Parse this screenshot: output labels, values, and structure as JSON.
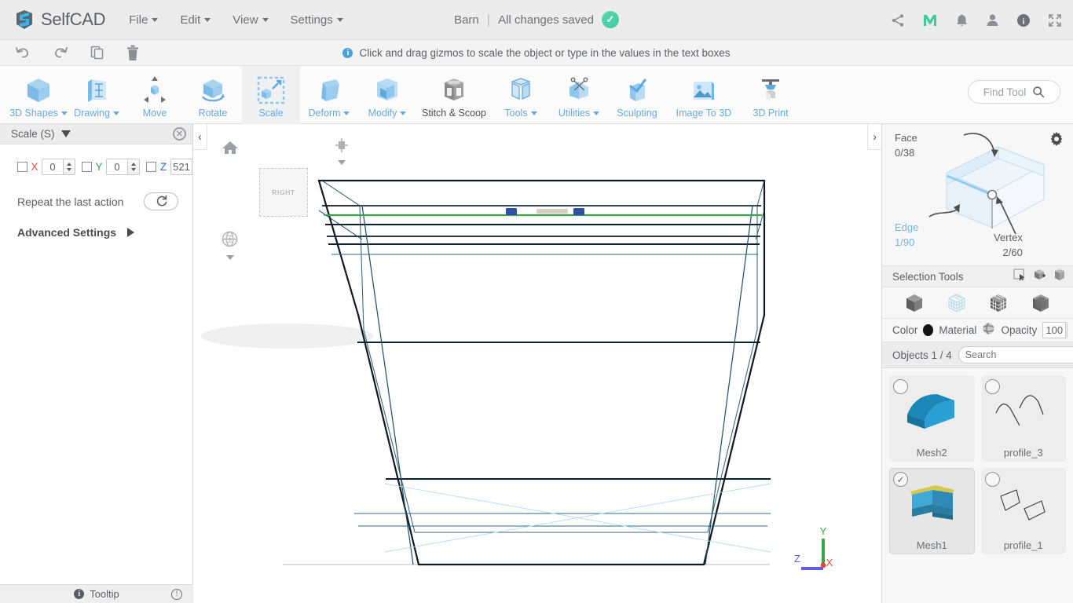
{
  "header": {
    "brand": "SelfCAD",
    "menus": [
      {
        "label": "File",
        "has_caret": true
      },
      {
        "label": "Edit",
        "has_caret": true
      },
      {
        "label": "View",
        "has_caret": true
      },
      {
        "label": "Settings",
        "has_caret": true
      }
    ],
    "doc_title": "Barn",
    "divider": "|",
    "save_status": "All changes saved",
    "icons": [
      {
        "name": "share-icon"
      },
      {
        "name": "m-logo-icon",
        "color": "#3fc9a0"
      },
      {
        "name": "bell-icon"
      },
      {
        "name": "user-icon"
      },
      {
        "name": "info-icon"
      },
      {
        "name": "fullscreen-icon"
      }
    ]
  },
  "subbar": {
    "undo_label": "Undo",
    "redo_label": "Redo",
    "copy_label": "Copy",
    "delete_label": "Delete",
    "hint": "Click and drag gizmos to scale the object or type in the values in the text boxes",
    "info_glyph": "i"
  },
  "ribbon": {
    "items": [
      {
        "label": "3D Shapes",
        "icon": "cube-icon",
        "caret": true,
        "active": false,
        "dark": false
      },
      {
        "label": "Drawing",
        "icon": "drawing-icon",
        "caret": true,
        "active": false,
        "dark": false
      },
      {
        "label": "Move",
        "icon": "move-icon",
        "caret": false,
        "active": false,
        "dark": false
      },
      {
        "label": "Rotate",
        "icon": "rotate-icon",
        "caret": false,
        "active": false,
        "dark": false
      },
      {
        "label": "Scale",
        "icon": "scale-icon",
        "caret": false,
        "active": true,
        "dark": false
      },
      {
        "label": "Deform",
        "icon": "deform-icon",
        "caret": true,
        "active": false,
        "dark": false
      },
      {
        "label": "Modify",
        "icon": "modify-icon",
        "caret": true,
        "active": false,
        "dark": false
      },
      {
        "label": "Stitch & Scoop",
        "icon": "stitch-scoop-icon",
        "caret": false,
        "active": false,
        "dark": true
      },
      {
        "label": "Tools",
        "icon": "tools-icon",
        "caret": true,
        "active": false,
        "dark": false
      },
      {
        "label": "Utilities",
        "icon": "utilities-icon",
        "caret": true,
        "active": false,
        "dark": false
      },
      {
        "label": "Sculpting",
        "icon": "sculpting-icon",
        "caret": false,
        "active": false,
        "dark": false
      },
      {
        "label": "Image To 3D",
        "icon": "image-to-3d-icon",
        "caret": false,
        "active": false,
        "dark": false
      },
      {
        "label": "3D Print",
        "icon": "3d-print-icon",
        "caret": false,
        "active": false,
        "dark": false
      }
    ],
    "find_tool_placeholder": "Find Tool"
  },
  "left_panel": {
    "title": "Scale (S)",
    "axes": [
      {
        "label": "X",
        "value": "0",
        "checked": false,
        "color": "#e04a3f"
      },
      {
        "label": "Y",
        "value": "0",
        "checked": false,
        "color": "#3aa349"
      },
      {
        "label": "Z",
        "value": "521",
        "checked": false,
        "color": "#2d5fd0"
      }
    ],
    "repeat_label": "Repeat the last action",
    "advanced_label": "Advanced Settings",
    "footer_label": "Tooltip"
  },
  "viewport": {
    "view_cube_label": "RIGHT",
    "home_icon": "home-icon",
    "globe_icon": "globe-icon",
    "grid_icon": "grid-view-icon",
    "collapse_left": "‹",
    "collapse_right": "›",
    "axis_gizmo": {
      "x_label": "X",
      "x_color": "#e04a3f",
      "y_label": "Y",
      "y_color": "#3aa349",
      "z_label": "Z",
      "z_color": "#5f5fe0"
    }
  },
  "right_panel": {
    "counters": [
      {
        "name": "Face",
        "value": "0/38",
        "highlight": false
      },
      {
        "name": "Edge",
        "value": "1/90",
        "highlight": true
      },
      {
        "name": "Vertex",
        "value": "2/60",
        "highlight": false
      }
    ],
    "selection_tools_label": "Selection Tools",
    "selection_tool_icons": [
      "rect-select-icon",
      "box-add-select-icon",
      "box-remove-select-icon"
    ],
    "mode_icons": [
      "object-mode-icon",
      "wireframe-mode-icon",
      "face-mode-icon",
      "vertex-mode-icon"
    ],
    "color_label": "Color",
    "color_value": "#141414",
    "material_label": "Material",
    "opacity_label": "Opacity",
    "opacity_value": "100",
    "objects_label": "Objects 1 / 4",
    "search_placeholder": "Search",
    "objects": [
      {
        "name": "Mesh2",
        "selected": false,
        "thumb": "mesh-curved-roof"
      },
      {
        "name": "profile_3",
        "selected": false,
        "thumb": "profile-curves"
      },
      {
        "name": "Mesh1",
        "selected": true,
        "thumb": "mesh-barn"
      },
      {
        "name": "profile_1",
        "selected": false,
        "thumb": "profile-quads"
      }
    ]
  }
}
